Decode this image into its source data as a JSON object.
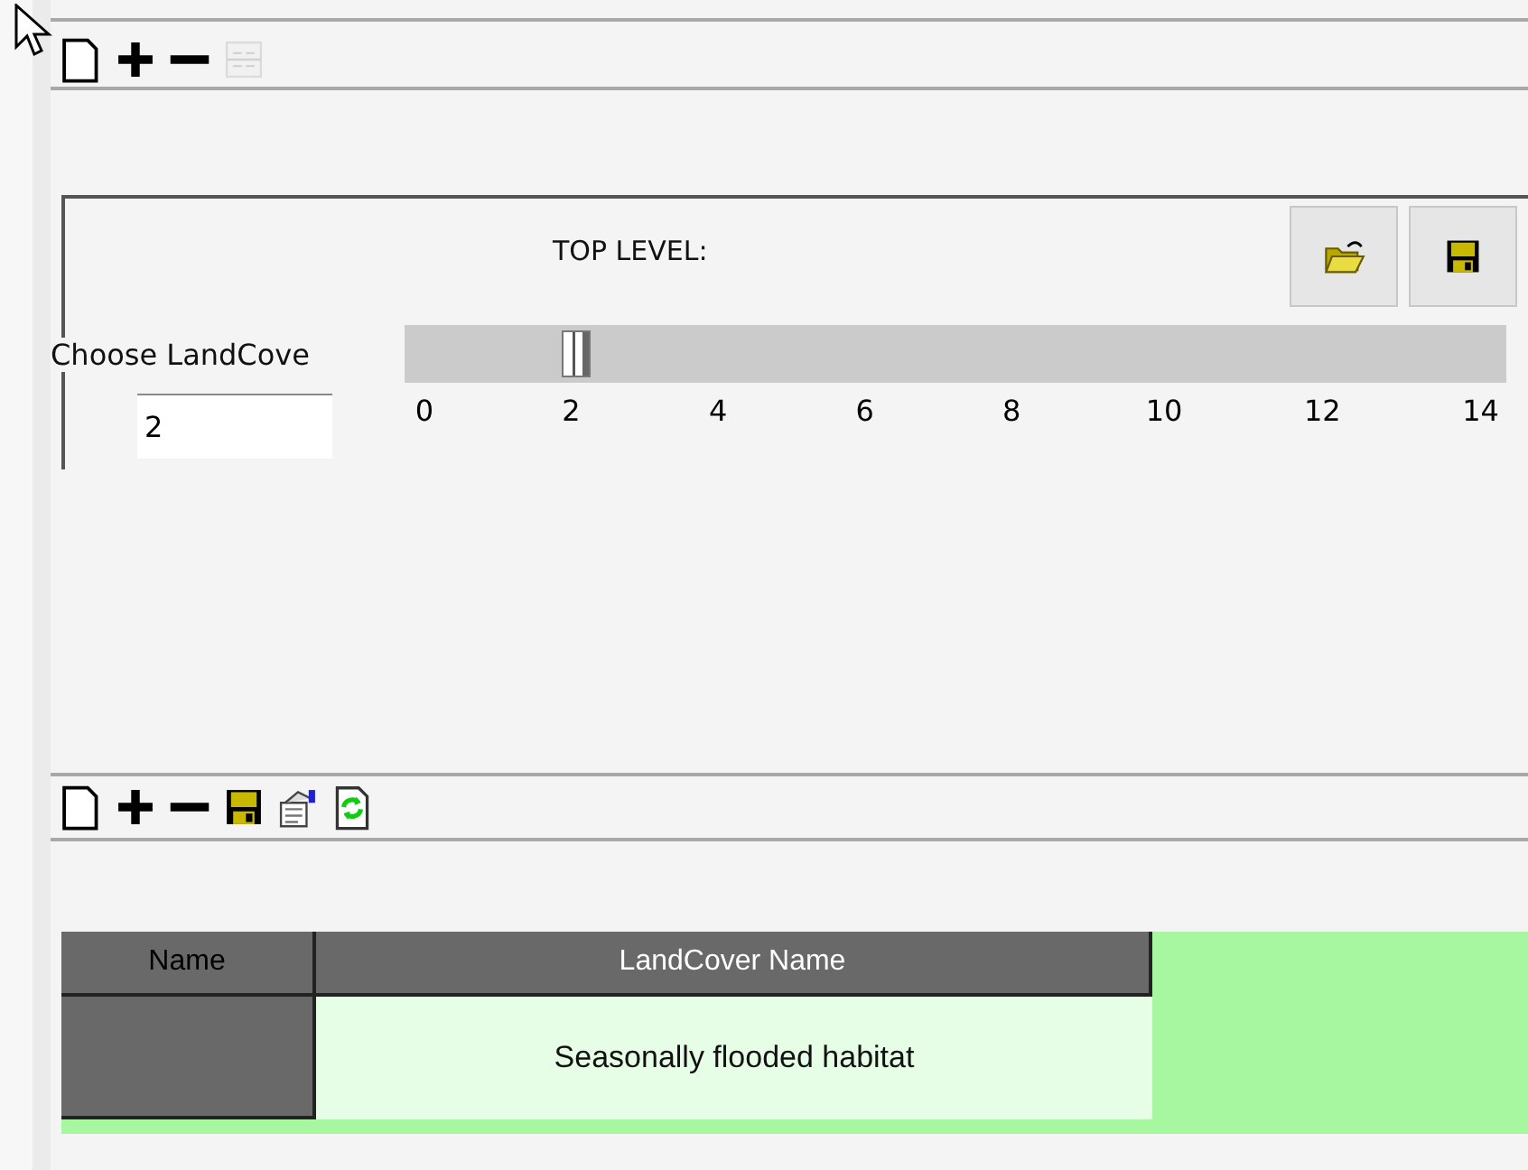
{
  "toolbar_top": {
    "buttons": [
      {
        "kind": "new",
        "disabled": false
      },
      {
        "kind": "add",
        "disabled": false
      },
      {
        "kind": "remove",
        "disabled": false
      },
      {
        "kind": "grid",
        "disabled": true
      }
    ]
  },
  "group": {
    "title": "TOP LEVEL:",
    "buttons": [
      {
        "kind": "open"
      },
      {
        "kind": "save"
      }
    ],
    "slider": {
      "label": "Choose LandCove",
      "value": "2",
      "level": 0.1429,
      "ticks": [
        "0",
        "2",
        "4",
        "6",
        "8",
        "10",
        "12",
        "14"
      ]
    }
  },
  "toolbar_bottom": {
    "buttons": [
      {
        "kind": "new",
        "disabled": false
      },
      {
        "kind": "add",
        "disabled": false
      },
      {
        "kind": "remove",
        "disabled": false
      },
      {
        "kind": "save",
        "disabled": false
      },
      {
        "kind": "properties",
        "disabled": false
      },
      {
        "kind": "refresh",
        "disabled": false
      }
    ]
  },
  "table": {
    "columns": [
      "Name",
      "LandCover Name"
    ],
    "rows": [
      {
        "landcover_name": "Seasonally flooded habitat"
      }
    ]
  }
}
